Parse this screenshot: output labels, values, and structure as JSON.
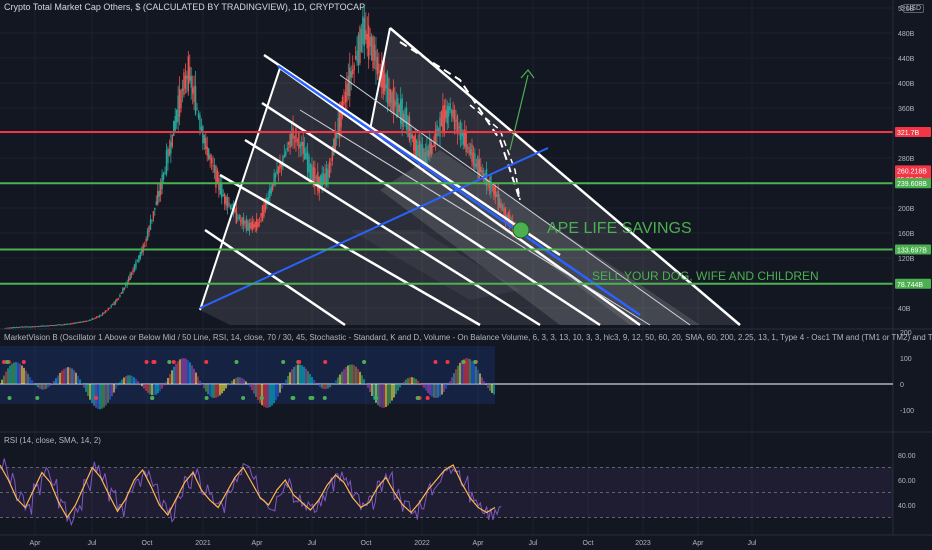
{
  "header": {
    "symbol_title": "Crypto Total Market Cap Others, $ (CALCULATED BY TRADINGVIEW), 1D, CRYPTOCAP",
    "currency_button": "USD",
    "scale_mode_label": "S"
  },
  "annotations": {
    "ape_text": "APE LIFE SAVINGS",
    "sell_text": "SELL YOUR DOG, WIFE AND CHILDREN"
  },
  "indicators": {
    "marketvision_title": "MarketVision B (Oscillator 1 Above or Below Mid / 50 Line, RSI, 14, close, 70 / 30, 45, Stochastic - Standard, K and D, Volume - On Balance Volume, 6, 3, 3, 13, 10, 3, 3, hlc3, 9, 12, 50, 60, 20, SMA, 60, 200, 2.25, 13, 1, Type 4 - Osc1 TM and (TM1 or TM2) and TM3, 3,",
    "rsi_title": "RSI (14, close, SMA, 14, 2)"
  },
  "colors": {
    "background": "#131722",
    "red_line": "#f23645",
    "green_line": "#4caf50",
    "blue_line": "#2962ff",
    "white_lines": "#ffffff",
    "candle_up": "#26a69a",
    "candle_down": "#ef5350",
    "rsi_line": "#7e57c2",
    "rsi_ma": "#ffb74d",
    "text_green": "#4caf50"
  },
  "chart_data": {
    "type": "line",
    "title": "Crypto Total Market Cap Others, $ (CALCULATED BY TRADINGVIEW), 1D, CRYPTOCAP",
    "price_axis_ticks": [
      "520B",
      "480B",
      "440B",
      "400B",
      "360B",
      "320B",
      "280B",
      "240B",
      "200B",
      "160B",
      "120B",
      "80B",
      "40B"
    ],
    "price_markers": [
      {
        "value": "321.7B",
        "color": "#f23645"
      },
      {
        "value": "260.218B",
        "color": "#f23645",
        "sub": "05:26:33"
      },
      {
        "value": "239.608B",
        "color": "#4caf50"
      },
      {
        "value": "133.697B",
        "color": "#4caf50"
      },
      {
        "value": "78.744B",
        "color": "#4caf50"
      }
    ],
    "time_axis_ticks": [
      "Apr",
      "Jul",
      "Oct",
      "2021",
      "Apr",
      "Jul",
      "Oct",
      "2022",
      "Apr",
      "Jul",
      "Oct",
      "2023",
      "Apr",
      "Jul"
    ],
    "series": [
      {
        "name": "Price",
        "values_B": [
          8,
          9,
          10,
          10,
          11,
          12,
          13,
          14,
          16,
          18,
          22,
          28,
          40,
          55,
          80,
          110,
          140,
          190,
          240,
          300,
          370,
          420,
          360,
          300,
          260,
          220,
          200,
          180,
          170,
          175,
          210,
          250,
          280,
          320,
          300,
          260,
          240,
          250,
          320,
          380,
          430,
          480,
          460,
          420,
          380,
          360,
          340,
          300,
          280,
          300,
          340,
          360,
          330,
          300,
          270,
          250,
          230,
          200,
          175,
          160
        ]
      }
    ],
    "horizontal_levels_B": [
      321.7,
      239.608,
      133.697,
      78.744
    ],
    "oscillator_axis_ticks": [
      "200",
      "100",
      "0",
      "-100"
    ],
    "rsi_axis_ticks": [
      "80.00",
      "60.00",
      "40.00"
    ],
    "rsi_values": [
      72,
      60,
      45,
      38,
      52,
      66,
      58,
      42,
      30,
      40,
      55,
      70,
      62,
      48,
      35,
      45,
      60,
      68,
      55,
      40,
      32,
      45,
      58,
      66,
      52,
      44,
      38,
      50,
      62,
      70,
      58,
      46,
      40,
      52,
      60,
      48,
      42,
      36,
      44,
      56,
      64,
      58,
      46,
      38,
      42,
      54,
      62,
      50,
      40,
      34,
      42,
      52,
      60,
      68,
      72,
      58,
      46,
      38,
      34,
      38
    ]
  }
}
